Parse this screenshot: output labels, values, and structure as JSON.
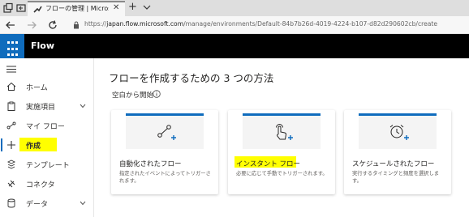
{
  "browser": {
    "tab_title": "フローの管理 | Microsoft F",
    "url_host": "japan.flow.microsoft.com",
    "url_prefix": "https://",
    "url_path": "/manage/environments/Default-84b7b26d-4019-4224-b107-d82d290602cb/create"
  },
  "app": {
    "brand": "Flow",
    "accent": "#0f6cbd",
    "highlight": "#ffff00"
  },
  "sidebar": {
    "items": [
      {
        "label": "ホーム",
        "icon": "home-icon"
      },
      {
        "label": "実施項目",
        "icon": "clipboard-icon"
      },
      {
        "label": "マイ フロー",
        "icon": "flow-icon"
      },
      {
        "label": "作成",
        "icon": "plus-icon"
      },
      {
        "label": "テンプレート",
        "icon": "template-icon"
      },
      {
        "label": "コネクタ",
        "icon": "connector-icon"
      },
      {
        "label": "データ",
        "icon": "database-icon"
      }
    ]
  },
  "main": {
    "title": "フローを作成するための 3 つの方法",
    "subtitle": "空白から開始",
    "cards": [
      {
        "title": "自動化されたフロー",
        "desc": "指定されたイベントによってトリガーされます。",
        "icon": "automated-flow-icon"
      },
      {
        "title": "インスタント フロー",
        "desc": "必要に応じて手動でトリガーされます。",
        "icon": "touch-icon"
      },
      {
        "title": "スケジュールされたフロー",
        "desc": "実行するタイミングと頻度を選択します。",
        "icon": "alarm-clock-icon"
      }
    ]
  }
}
